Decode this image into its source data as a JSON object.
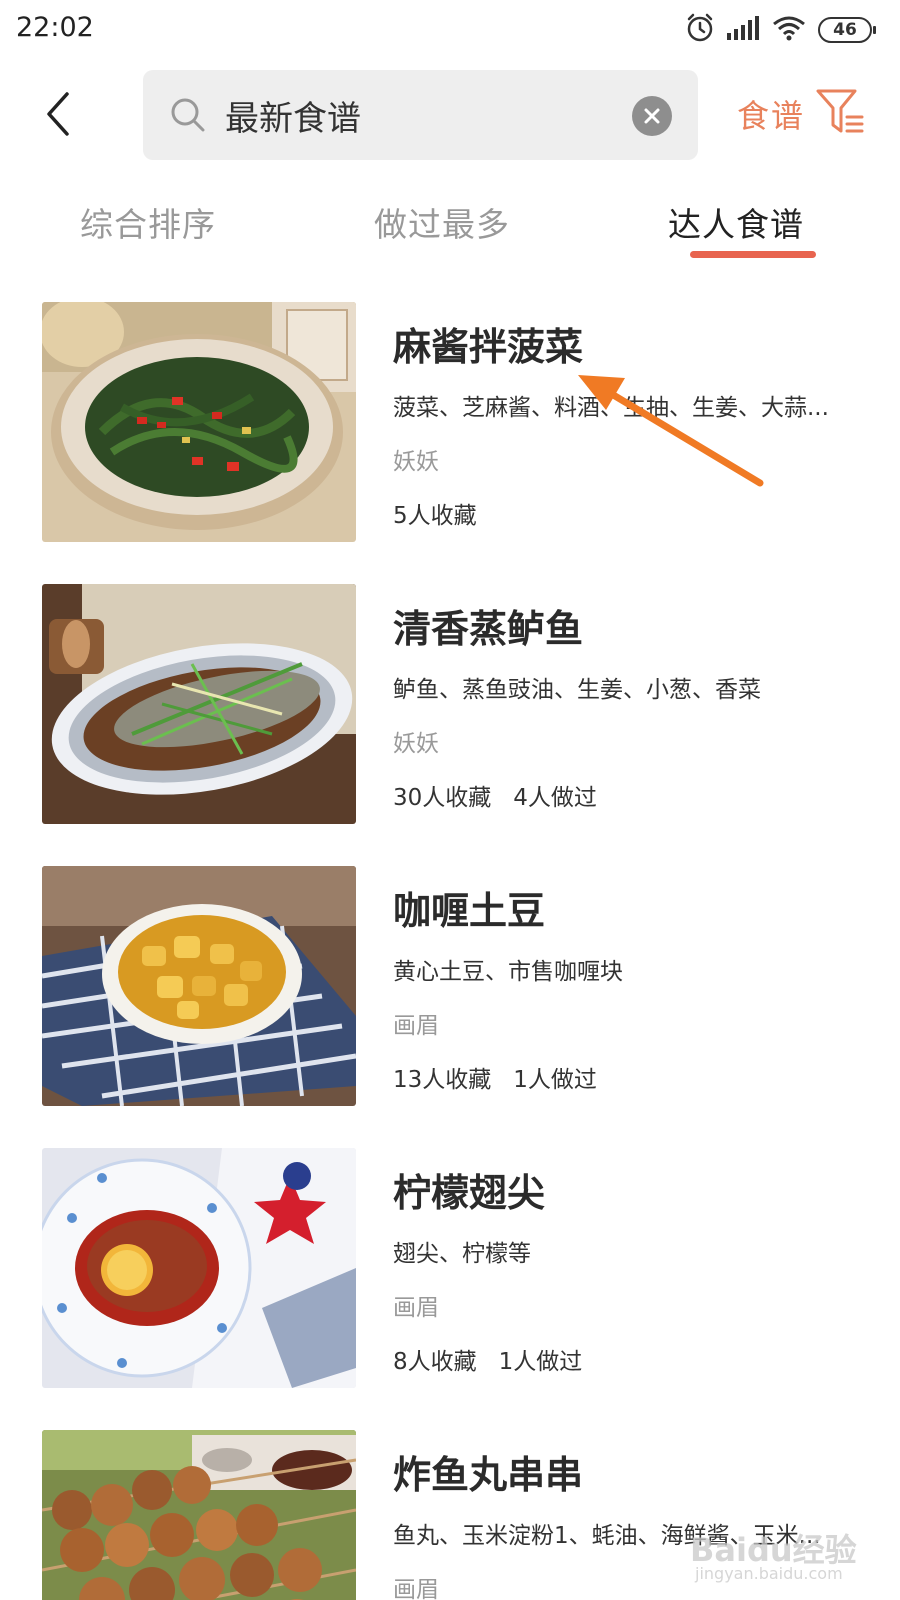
{
  "status_bar": {
    "time": "22:02",
    "battery": "46",
    "icons": [
      "alarm-icon",
      "signal-icon",
      "wifi-icon",
      "battery-icon"
    ]
  },
  "search": {
    "value": "最新食谱",
    "placeholder": "最新食谱"
  },
  "header": {
    "filter_label": "食谱",
    "accent_color": "#e8825c"
  },
  "tabs": [
    {
      "label": "综合排序",
      "active": false
    },
    {
      "label": "做过最多",
      "active": false
    },
    {
      "label": "达人食谱",
      "active": true
    }
  ],
  "recipes": [
    {
      "title": "麻酱拌菠菜",
      "ingredients": "菠菜、芝麻酱、料酒、生抽、生姜、大蒜...",
      "author": "妖妖",
      "stats": "5人收藏"
    },
    {
      "title": "清香蒸鲈鱼",
      "ingredients": "鲈鱼、蒸鱼豉油、生姜、小葱、香菜",
      "author": "妖妖",
      "stats": "30人收藏   4人做过"
    },
    {
      "title": "咖喱土豆",
      "ingredients": "黄心土豆、市售咖喱块",
      "author": "画眉",
      "stats": "13人收藏   1人做过"
    },
    {
      "title": "柠檬翅尖",
      "ingredients": "翅尖、柠檬等",
      "author": "画眉",
      "stats": "8人收藏   1人做过"
    },
    {
      "title": "炸鱼丸串串",
      "ingredients": "鱼丸、玉米淀粉1、蚝油、海鲜酱、玉米...",
      "author": "画眉",
      "stats": ""
    }
  ],
  "watermark": {
    "text": "Baidu经验",
    "sub": "jingyan.baidu.com"
  }
}
